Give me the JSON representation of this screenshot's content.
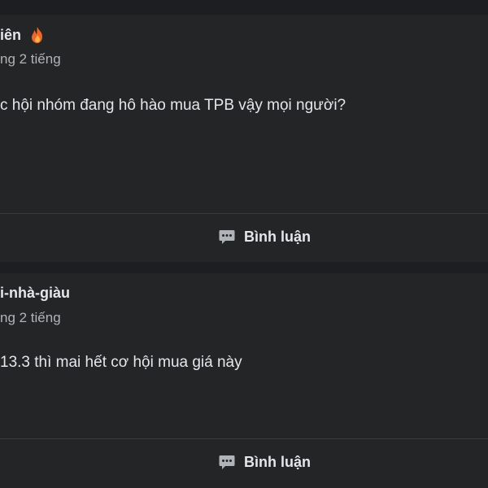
{
  "posts": [
    {
      "author": "iên",
      "badge_icon": "fire-icon",
      "meta": "ng 2 tiếng",
      "text": "c hội nhóm đang hô hào mua TPB vậy mọi người?",
      "comment_label": "Bình luận"
    },
    {
      "author": "i-nhà-giàu",
      "meta": "ng 2 tiếng",
      "text": "13.3 thì mai hết cơ hội mua giá này",
      "comment_label": "Bình luận"
    }
  ],
  "colors": {
    "page_bg": "#1c1e21",
    "card_bg": "#242526",
    "text_primary": "#e4e6eb",
    "text_secondary": "#b0b3b8",
    "divider": "#3a3b3c",
    "fire": "#f26522"
  }
}
